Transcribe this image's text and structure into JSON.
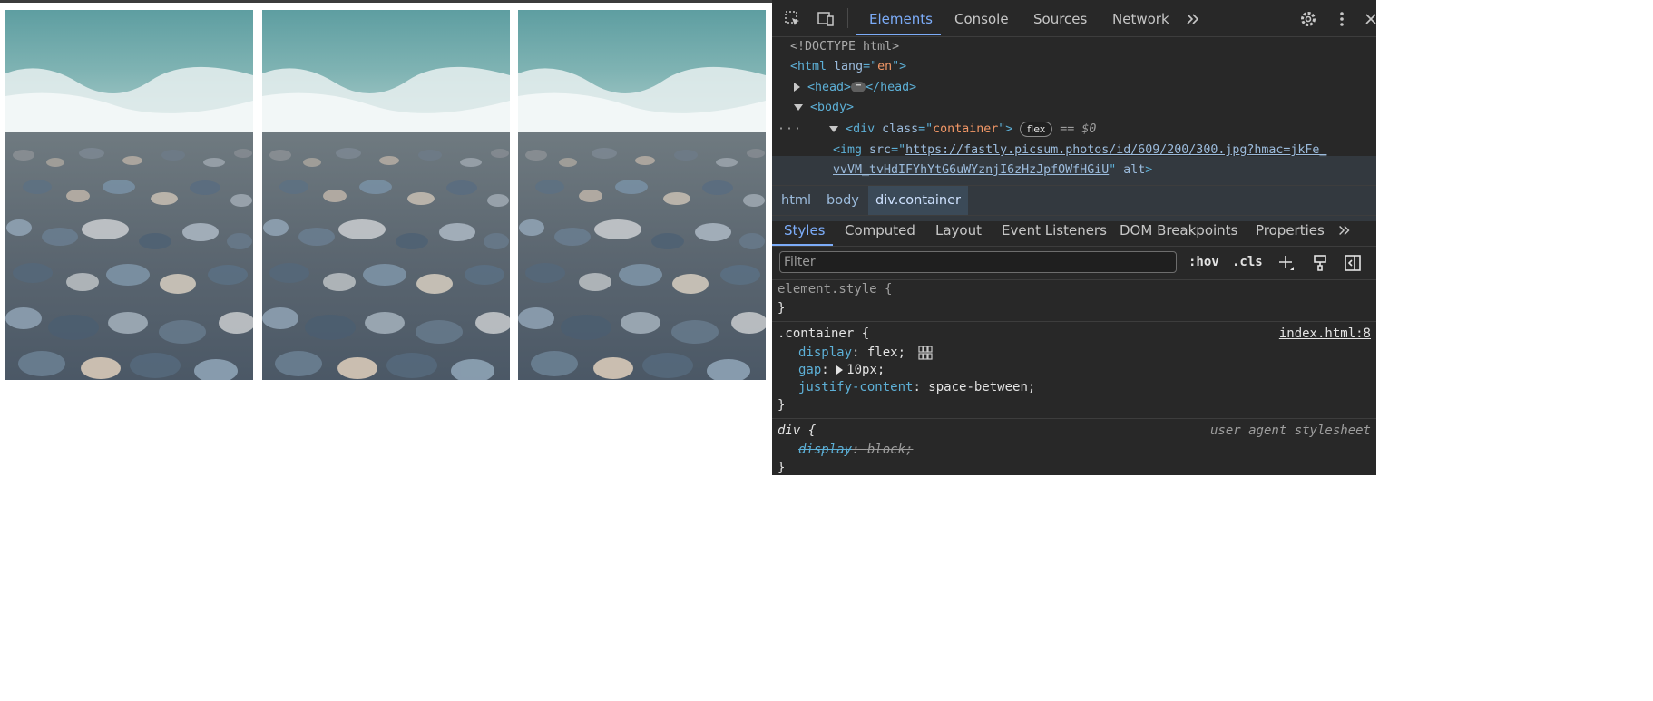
{
  "page": {
    "images": [
      {
        "alt": "pebble beach photo 1"
      },
      {
        "alt": "pebble beach photo 2"
      },
      {
        "alt": "pebble beach photo 3"
      }
    ]
  },
  "devtools": {
    "tabs": [
      {
        "label": "Elements",
        "active": true
      },
      {
        "label": "Console"
      },
      {
        "label": "Sources"
      },
      {
        "label": "Network"
      }
    ],
    "more_tabs_icon": "double-chevron-right",
    "dom": {
      "doctype": "<!DOCTYPE html>",
      "html_open_tag": "<html",
      "html_attr_name": "lang",
      "html_attr_eq": "=\"",
      "html_attr_value": "en",
      "html_attr_close": "\">",
      "head_open": "<head>",
      "head_close": "</head>",
      "body_open": "<body>",
      "div_open": "<div",
      "div_attr_name": "class",
      "div_attr_value": "container",
      "flex_badge": "flex",
      "selected_marker": "== $0",
      "img_open": "<img",
      "img_attr_name": "src",
      "img_src_line1": "https://fastly.picsum.photos/id/609/200/300.jpg?hmac=jkFe_",
      "img_src_line2": "vvVM_tvHdIFYhYtG6uWYznjI6zHzJpfOWfHGiU",
      "img_alt_attr": "alt",
      "tag_close": ">",
      "quote_close": "\""
    },
    "breadcrumbs": [
      "html",
      "body",
      "div.container"
    ],
    "subtabs": [
      {
        "label": "Styles",
        "active": true
      },
      {
        "label": "Computed"
      },
      {
        "label": "Layout"
      },
      {
        "label": "Event Listeners"
      },
      {
        "label": "DOM Breakpoints"
      },
      {
        "label": "Properties"
      }
    ],
    "filter": {
      "placeholder": "Filter",
      "value": ""
    },
    "filter_buttons": {
      "hov": ":hov",
      "cls": ".cls"
    },
    "styles": {
      "element_style_selector": "element.style {",
      "close_brace": "}",
      "container_selector": ".container {",
      "container_source": "index.html:8",
      "decl_display_prop": "display",
      "decl_display_val": "flex;",
      "decl_gap_prop": "gap",
      "decl_gap_val": "10px;",
      "decl_justify_prop": "justify-content",
      "decl_justify_val": "space-between;",
      "colon": ": ",
      "div_selector": "div {",
      "ua_label": "user agent stylesheet",
      "ua_prop": "display",
      "ua_val": "block;"
    },
    "colors": {
      "background": "#282828",
      "accent": "#7cacf8",
      "tag": "#5db0d7",
      "attr_value": "#f29766",
      "selected_row": "#33393f"
    }
  }
}
